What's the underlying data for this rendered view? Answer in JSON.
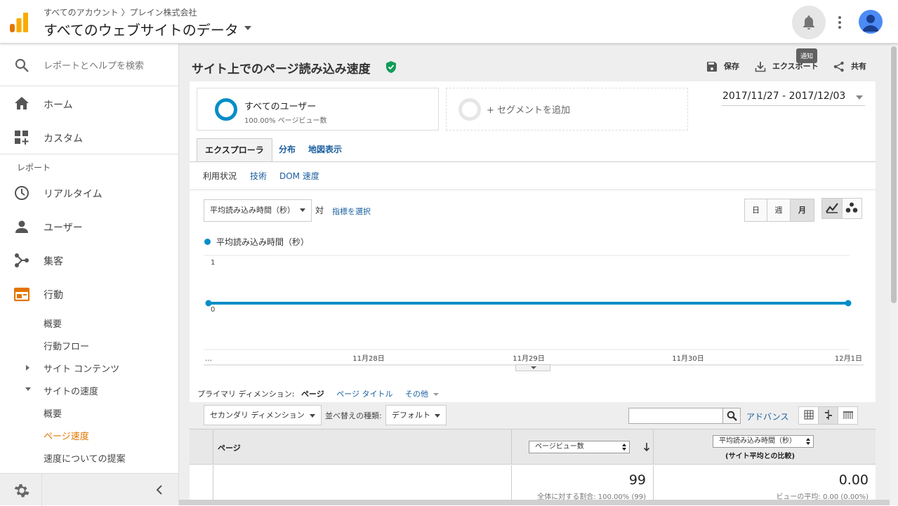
{
  "header": {
    "breadcrumb": "すべてのアカウント 〉プレイン株式会社",
    "title": "すべてのウェブサイトのデータ",
    "tooltip": "通知"
  },
  "sidebar": {
    "search_placeholder": "レポートとヘルプを検索",
    "home": "ホーム",
    "custom": "カスタム",
    "reports_heading": "レポート",
    "realtime": "リアルタイム",
    "users": "ユーザー",
    "acquisition": "集客",
    "behavior": "行動",
    "behavior_overview": "概要",
    "behavior_flow": "行動フロー",
    "site_content": "サイト コンテンツ",
    "site_speed": "サイトの速度",
    "speed_overview": "概要",
    "page_timings": "ページ速度",
    "speed_suggestions": "速度についての提案"
  },
  "report": {
    "title": "サイト上でのページ読み込み速度",
    "save": "保存",
    "export": "エクスポート",
    "share": "共有"
  },
  "segments": {
    "all_users": "すべてのユーザー",
    "all_users_sub": "100.00% ページビュー数",
    "add_segment": "+ セグメントを追加"
  },
  "date_range": "2017/11/27 - 2017/12/03",
  "tabs": [
    "エクスプローラ",
    "分布",
    "地図表示"
  ],
  "subtabs": [
    "利用状況",
    "技術",
    "DOM 速度"
  ],
  "metric": {
    "select": "平均読み込み時間（秒）",
    "vs": "対",
    "choose": "指標を選択"
  },
  "granularity": [
    "日",
    "週",
    "月"
  ],
  "chart_data": {
    "type": "line",
    "x": [
      "…",
      "11月28日",
      "11月29日",
      "11月30日",
      "12月1日"
    ],
    "series": [
      {
        "name": "平均読み込み時間（秒）",
        "values": [
          0,
          0,
          0,
          0,
          0
        ]
      }
    ],
    "yticks": [
      "1",
      "0"
    ],
    "ylim": [
      0,
      1
    ],
    "color": "#058dc7"
  },
  "table": {
    "primary_dim_label": "プライマリ ディメンション:",
    "primary_dim_value": "ページ",
    "dim_page_title": "ページ タイトル",
    "dim_other": "その他",
    "secondary_dim": "セカンダリ ディメンション",
    "sort_label": "並べ替えの種類:",
    "sort_value": "デフォルト",
    "advanced": "アドバンス",
    "col_page": "ページ",
    "col_pageviews": "ページビュー数",
    "col_load_time": "平均読み込み時間（秒）",
    "col_load_time_sub": "(サイト平均との比較)",
    "total_pageviews": "99",
    "total_pageviews_note": "全体に対する割合: 100.00% (99)",
    "total_load": "0.00",
    "total_load_note": "ビューの平均: 0.00 (0.00%)"
  }
}
